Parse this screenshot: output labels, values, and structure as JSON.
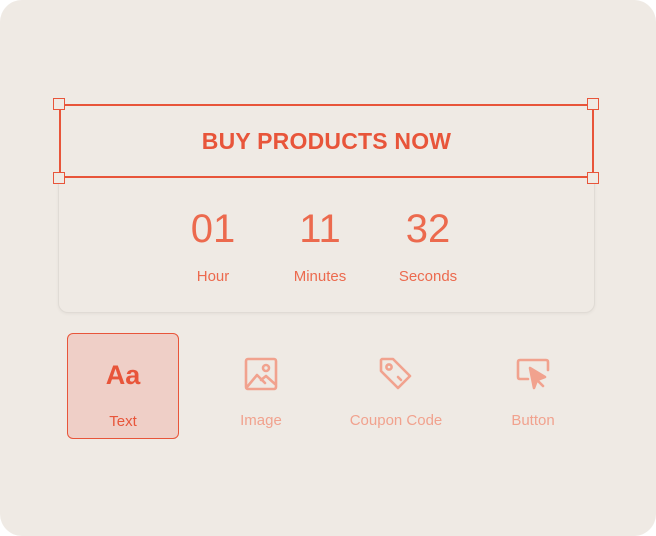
{
  "headline": {
    "text": "BUY PRODUCTS NOW"
  },
  "countdown": [
    {
      "value": "01",
      "label": "Hour"
    },
    {
      "value": "11",
      "label": "Minutes"
    },
    {
      "value": "32",
      "label": "Seconds"
    }
  ],
  "toolbar": {
    "items": [
      {
        "label": "Text",
        "icon": "text-aa-icon",
        "glyph": "Aa",
        "active": true
      },
      {
        "label": "Image",
        "icon": "image-icon",
        "active": false
      },
      {
        "label": "Coupon Code",
        "icon": "tag-icon",
        "active": false
      },
      {
        "label": "Button",
        "icon": "cursor-click-icon",
        "active": false
      }
    ]
  },
  "colors": {
    "accent": "#e8553a",
    "muted": "#f1a28e",
    "background": "#efeae4",
    "active_fill": "#efcfc7"
  }
}
